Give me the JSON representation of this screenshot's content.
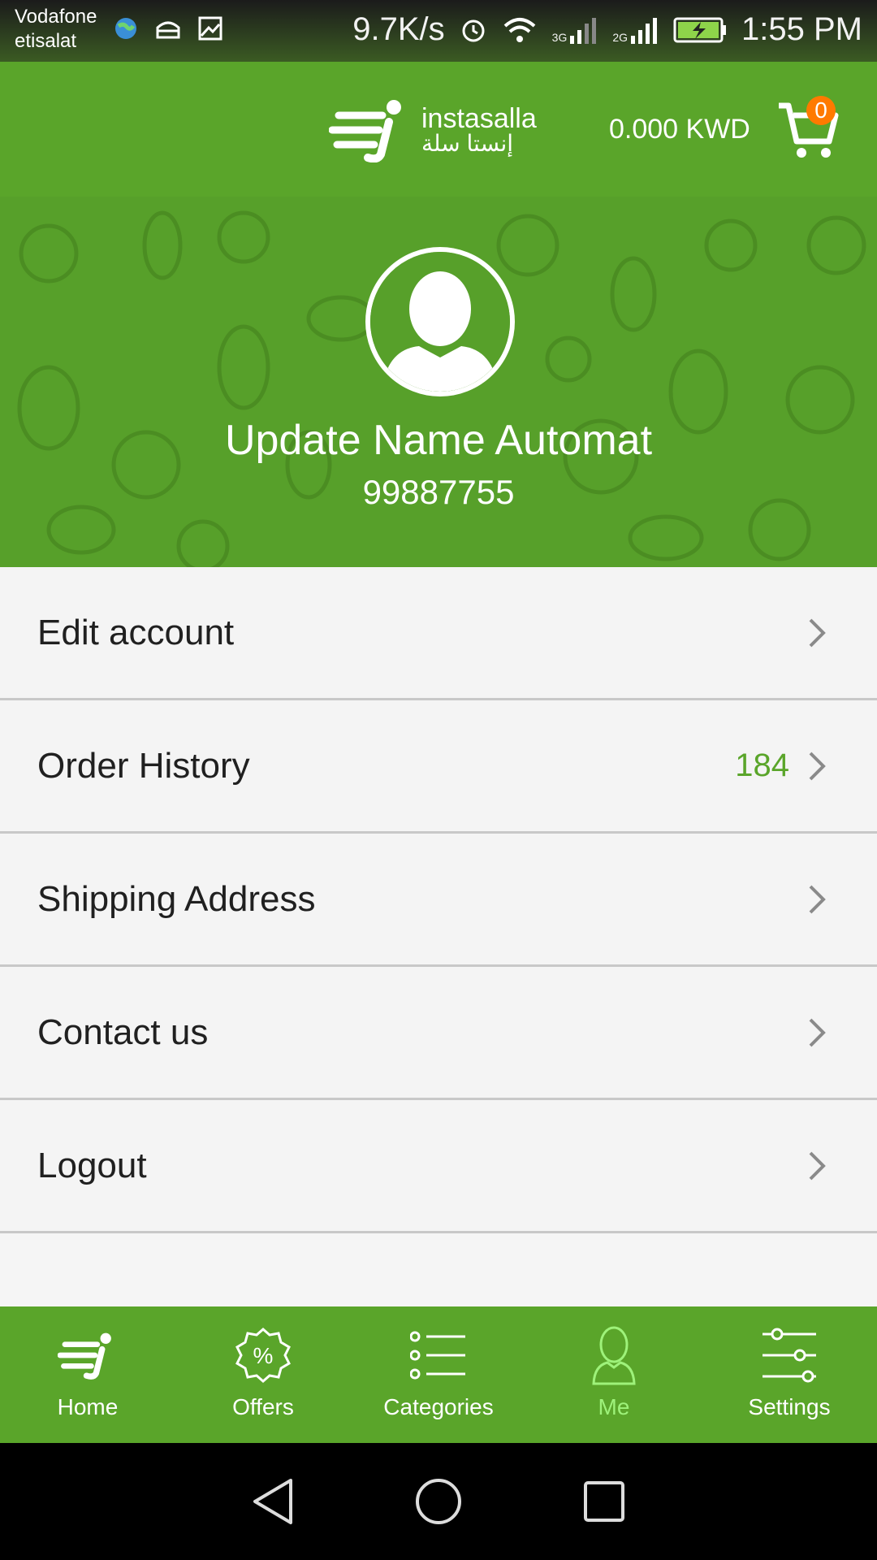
{
  "status_bar": {
    "carrier_1": "Vodafone",
    "carrier_2": "etisalat",
    "speed": "9.7K/s",
    "net_1": "3G",
    "net_2": "2G",
    "time": "1:55 PM"
  },
  "header": {
    "logo_en": "instasalla",
    "logo_ar": "إنستا سلة",
    "cart_total": "0.000 KWD",
    "cart_count": "0"
  },
  "profile": {
    "name": "Update Name Automat",
    "phone": "99887755"
  },
  "menu": {
    "items": [
      {
        "label": "Edit account",
        "count": ""
      },
      {
        "label": "Order History",
        "count": "184"
      },
      {
        "label": "Shipping Address",
        "count": ""
      },
      {
        "label": "Contact us",
        "count": ""
      },
      {
        "label": "Logout",
        "count": ""
      }
    ]
  },
  "bottom_nav": {
    "items": [
      {
        "label": "Home",
        "icon": "home-logo-icon"
      },
      {
        "label": "Offers",
        "icon": "percent-badge-icon"
      },
      {
        "label": "Categories",
        "icon": "list-icon"
      },
      {
        "label": "Me",
        "icon": "person-icon",
        "active": true
      },
      {
        "label": "Settings",
        "icon": "sliders-icon"
      }
    ]
  },
  "colors": {
    "brand_green": "#5aa52a",
    "active_tab": "#9ef27a",
    "badge": "#ff7a00"
  }
}
